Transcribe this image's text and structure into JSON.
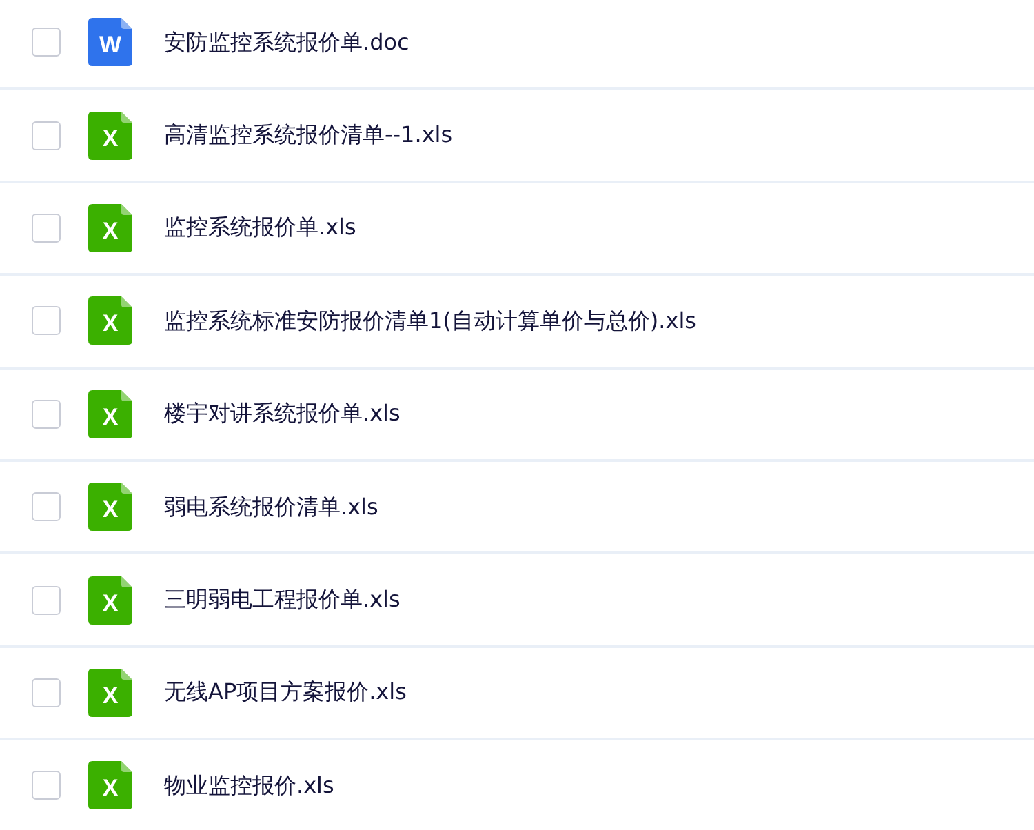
{
  "files": [
    {
      "kind": "doc",
      "icon_letter": "W",
      "name": "安防监控系统报价单.doc",
      "checked": false
    },
    {
      "kind": "xls",
      "icon_letter": "X",
      "name": "高清监控系统报价清单--1.xls",
      "checked": false
    },
    {
      "kind": "xls",
      "icon_letter": "X",
      "name": "监控系统报价单.xls",
      "checked": false
    },
    {
      "kind": "xls",
      "icon_letter": "X",
      "name": "监控系统标准安防报价清单1(自动计算单价与总价).xls",
      "checked": false
    },
    {
      "kind": "xls",
      "icon_letter": "X",
      "name": "楼宇对讲系统报价单.xls",
      "checked": false
    },
    {
      "kind": "xls",
      "icon_letter": "X",
      "name": "弱电系统报价清单.xls",
      "checked": false
    },
    {
      "kind": "xls",
      "icon_letter": "X",
      "name": "三明弱电工程报价单.xls",
      "checked": false
    },
    {
      "kind": "xls",
      "icon_letter": "X",
      "name": "无线AP项目方案报价.xls",
      "checked": false
    },
    {
      "kind": "xls",
      "icon_letter": "X",
      "name": "物业监控报价.xls",
      "checked": false
    }
  ]
}
